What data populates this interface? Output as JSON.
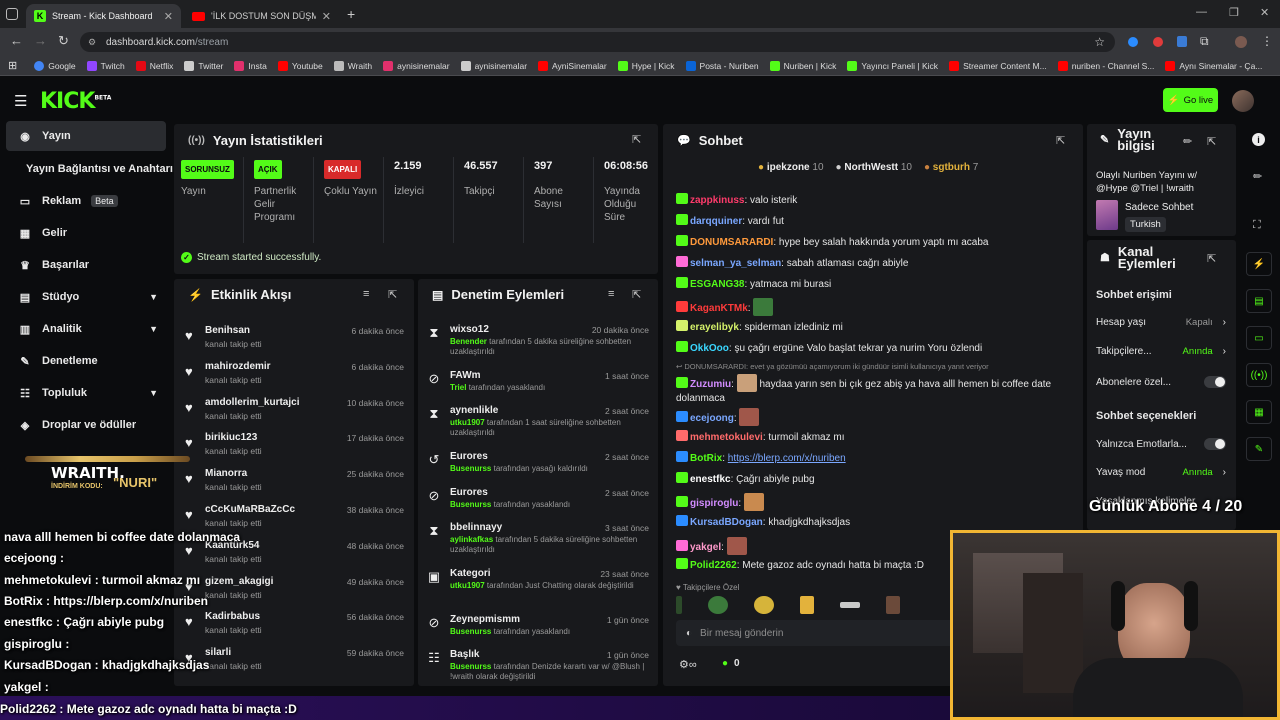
{
  "browser": {
    "tabs": [
      {
        "label": "Stream - Kick Dashboard",
        "active": true
      },
      {
        "label": "'İLK DOSTUM SON DÜŞMANIM",
        "active": false
      }
    ],
    "url_host": "dashboard.kick.com",
    "url_path": "/stream",
    "bookmarks": [
      {
        "label": "Google",
        "color": "#4285f4"
      },
      {
        "label": "Twitch",
        "color": "#9146ff"
      },
      {
        "label": "Netflix",
        "color": "#e50914"
      },
      {
        "label": "Twitter",
        "color": "#cccccc"
      },
      {
        "label": "Insta",
        "color": "#e1306c"
      },
      {
        "label": "Youtube",
        "color": "#ff0000"
      },
      {
        "label": "Wraith",
        "color": "#bbbbbb"
      },
      {
        "label": "aynisinemalar",
        "color": "#e1306c"
      },
      {
        "label": "aynisinemalar",
        "color": "#cccccc"
      },
      {
        "label": "AyniSinemalar",
        "color": "#ff0000"
      },
      {
        "label": "Hype | Kick",
        "color": "#53fc18"
      },
      {
        "label": "Posta - Nuriben",
        "color": "#0a64d6"
      },
      {
        "label": "Nuriben | Kick",
        "color": "#53fc18"
      },
      {
        "label": "Yayıncı Paneli | Kick",
        "color": "#53fc18"
      },
      {
        "label": "Streamer Content M...",
        "color": "#ff0000"
      },
      {
        "label": "nuriben - Channel S...",
        "color": "#ff0000"
      },
      {
        "label": "Aynı Sinemalar - Ça...",
        "color": "#ff0000"
      }
    ]
  },
  "header": {
    "logo": "KICK",
    "logo_beta": "BETA",
    "go_live": "Go live"
  },
  "sidebar": {
    "items": [
      {
        "label": "Yayın",
        "icon": "broadcast-icon",
        "active": true
      },
      {
        "label": "Yayın Bağlantısı ve Anahtarı",
        "icon": "",
        "active": false
      },
      {
        "label": "Reklam",
        "badge": "Beta",
        "icon": "tv-icon"
      },
      {
        "label": "Gelir",
        "icon": "table-icon"
      },
      {
        "label": "Başarılar",
        "icon": "trophy-icon"
      },
      {
        "label": "Stüdyo",
        "icon": "grid-icon",
        "chevron": true
      },
      {
        "label": "Analitik",
        "icon": "chart-icon",
        "chevron": true
      },
      {
        "label": "Denetleme",
        "icon": "wrench-icon"
      },
      {
        "label": "Topluluk",
        "icon": "community-icon",
        "chevron": true
      },
      {
        "label": "Droplar ve ödüller",
        "icon": "drop-icon"
      }
    ]
  },
  "stats": {
    "title": "Yayın İstatistikleri",
    "columns": [
      {
        "badge": "SORUNSUZ",
        "label": "Yayın"
      },
      {
        "badge": "AÇIK",
        "label": "Partnerlik Gelir Programı"
      },
      {
        "badge": "KAPALI",
        "label": "Çoklu Yayın"
      },
      {
        "value": "2.159",
        "label": "İzleyici"
      },
      {
        "value": "46.557",
        "label": "Takipçi"
      },
      {
        "value": "397",
        "label": "Abone Sayısı"
      },
      {
        "value": "06:08:56",
        "label": "Yayında Olduğu Süre"
      }
    ],
    "success": "Stream started successfully."
  },
  "activity": {
    "title": "Etkinlik Akışı",
    "items": [
      {
        "name": "Benihsan",
        "sub": "kanalı takip etti",
        "time": "6 dakika önce"
      },
      {
        "name": "mahirozdemir",
        "sub": "kanalı takip etti",
        "time": "6 dakika önce"
      },
      {
        "name": "amdollerim_kurtajci",
        "sub": "kanalı takip etti",
        "time": "10 dakika önce"
      },
      {
        "name": "birikiuc123",
        "sub": "kanalı takip etti",
        "time": "17 dakika önce"
      },
      {
        "name": "Mianorra",
        "sub": "kanalı takip etti",
        "time": "25 dakika önce"
      },
      {
        "name": "cCcKuMaRBaZcCc",
        "sub": "kanalı takip etti",
        "time": "38 dakika önce"
      },
      {
        "name": "Kaantürk54",
        "sub": "kanalı takip etti",
        "time": "48 dakika önce"
      },
      {
        "name": "gizem_akagigi",
        "sub": "kanalı takip etti",
        "time": "49 dakika önce"
      },
      {
        "name": "Kadirbabus",
        "sub": "kanalı takip etti",
        "time": "56 dakika önce"
      },
      {
        "name": "silarli",
        "sub": "kanalı takip etti",
        "time": "59 dakika önce"
      }
    ]
  },
  "moderation": {
    "title": "Denetim Eylemleri",
    "items": [
      {
        "icon": "hourglass-icon",
        "name": "wixso12",
        "actor": "Benender",
        "text": "tarafından 5 dakika süreliğine sohbetten uzaklaştırıldı",
        "time": "20 dakika önce"
      },
      {
        "icon": "ban-icon",
        "name": "FAWm",
        "actor": "Triel",
        "text": "tarafından yasaklandı",
        "time": "1 saat önce"
      },
      {
        "icon": "hourglass-icon",
        "name": "aynenlikle",
        "actor": "utku1907",
        "text": "tarafından 1 saat süreliğine sohbetten uzaklaştırıldı",
        "time": "2 saat önce"
      },
      {
        "icon": "undo-icon",
        "name": "Eurores",
        "actor": "Busenurss",
        "text": "tarafından yasağı kaldırıldı",
        "time": "2 saat önce"
      },
      {
        "icon": "ban-icon",
        "name": "Eurores",
        "actor": "Busenurss",
        "text": "tarafından yasaklandı",
        "time": "2 saat önce"
      },
      {
        "icon": "hourglass-icon",
        "name": "bbelinnayy",
        "actor": "aylinkafkas",
        "text": "tarafından 5 dakika süreliğine sohbetten uzaklaştırıldı",
        "time": "3 saat önce"
      },
      {
        "icon": "category-icon",
        "name": "Kategori",
        "actor": "utku1907",
        "text": "tarafından Just Chatting olarak değiştirildi",
        "time": "23 saat önce"
      },
      {
        "icon": "ban-icon",
        "name": "Zeynepmismm",
        "actor": "Busenurss",
        "text": "tarafından yasaklandı",
        "time": "1 gün önce"
      },
      {
        "icon": "title-icon",
        "name": "Başlık",
        "actor": "Busenurss",
        "text": "tarafından Denizde karartı var w/ @Blush | !wraith olarak değiştirildi",
        "time": "1 gün önce"
      }
    ]
  },
  "chat": {
    "title": "Sohbet",
    "top_gifters": [
      {
        "name": "ipekzone",
        "count": "10"
      },
      {
        "name": "NorthWestt",
        "count": "10"
      },
      {
        "name": "sgtburh",
        "count": "7"
      }
    ],
    "messages": [
      {
        "user": "zappkinuss",
        "color": "#ff3b6b",
        "text": "valo isterik"
      },
      {
        "user": "darqquiner",
        "color": "#7aa7ff",
        "text": "vardı fut"
      },
      {
        "user": "DONUMSARARDI",
        "color": "#ff9a3c",
        "text": "hype bey salah hakkında yorum yaptı mı acaba"
      },
      {
        "user": "selman_ya_selman",
        "color": "#7aa7ff",
        "text": "sabah atlaması cağrı abiyle"
      },
      {
        "user": "ESGANG38",
        "color": "#53fc18",
        "text": "yatmaca mi burasi"
      },
      {
        "user": "KaganKTMk",
        "color": "#ff3b3b",
        "text": ""
      },
      {
        "user": "erayelibyk",
        "color": "#d5f16a",
        "text": "spiderman izlediniz mi"
      },
      {
        "user": "OkkOoo",
        "color": "#3ad7ff",
        "text": "şu çağrı ergüne Valo başlat tekrar ya nurim Yoru özlendi"
      },
      {
        "reply": "DONUMSARARDI: evet ya gözümüü açamıyorum iki gündüür isimli kullanıcıya yanıt veriyor"
      },
      {
        "user": "Zuzumiu",
        "color": "#d28cff",
        "text": "haydaa yarın sen bi çık gez abiş ya hava alll hemen bi coffee date dolanmaca"
      },
      {
        "user": "ecejoong",
        "color": "#7aa7ff",
        "text": ""
      },
      {
        "user": "mehmetokulevi",
        "color": "#ff6b6b",
        "text": "turmoil akmaz mı"
      },
      {
        "user": "BotRix",
        "color": "#53fc18",
        "text": "https://blerp.com/x/nuriben"
      },
      {
        "user": "enestfkc",
        "color": "#ffffff",
        "text": "Çağrı abiyle pubg"
      },
      {
        "user": "gispiroglu",
        "color": "#d28cff",
        "text": ""
      },
      {
        "user": "KursadBDogan",
        "color": "#7aa7ff",
        "text": "khadjgkdhajksdjas"
      },
      {
        "user": "yakgel",
        "color": "#ff9acb",
        "text": ""
      },
      {
        "user": "Polid2262",
        "color": "#53fc18",
        "text": "Mete gazoz adc oynadı hatta bi maçta :D"
      }
    ],
    "follower_only": "Takipçilere Özel",
    "input_placeholder": "Bir mesaj gönderin",
    "points": "0"
  },
  "info": {
    "title": "Yayın bilgisi",
    "stream_title": "Olaylı Nuriben Yayını w/ @Hype @Triel | !wraith",
    "category": "Sadece Sohbet",
    "language": "Turkish",
    "channel_title": "Kanal Eylemleri",
    "access_title": "Sohbet erişimi",
    "access_rows": [
      {
        "label": "Hesap yaşı",
        "value": "Kapalı"
      },
      {
        "label": "Takipçilere...",
        "value": "Anında"
      },
      {
        "label": "Abonelere özel...",
        "toggle": true
      }
    ],
    "options_title": "Sohbet seçenekleri",
    "option_rows": [
      {
        "label": "Yalnızca Emotlarla...",
        "toggle": true
      },
      {
        "label": "Yavaş mod",
        "value": "Anında"
      },
      {
        "label": "Yasaklanmış kelimeler",
        "value": ""
      }
    ]
  },
  "overlay": {
    "sub_goal": "Günlük Abone 4 / 20",
    "wraith_brand": "WRAITH.",
    "wraith_code_label": "İNDİRİM KODU:",
    "wraith_code": "\"NURI\"",
    "chat_lines": [
      "nava alll hemen bi coffee date dolanmaca",
      "ecejoong :",
      "mehmetokulevi : turmoil akmaz mı",
      "BotRix : https://blerp.com/x/nuriben",
      "enestfkc : Çağrı abiyle pubg",
      "gispiroglu :",
      "KursadBDogan : khadjgkdhajksdjas",
      "yakgel :",
      "Polid2262 : Mete gazoz adc oynadı hatta bi maçta :D"
    ]
  }
}
